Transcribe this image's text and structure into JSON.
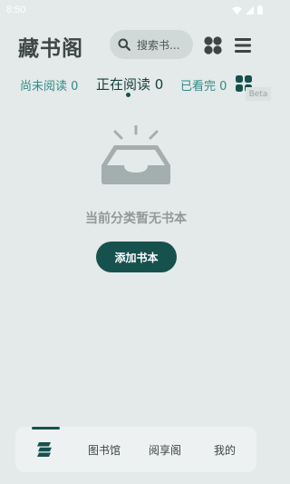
{
  "status_bar": {
    "time": "8:50",
    "icons": [
      "wifi-icon",
      "signal-icon",
      "battery-icon"
    ]
  },
  "header": {
    "title": "藏书阁",
    "search_placeholder": "搜索书...",
    "grid_icon": "apps-icon",
    "menu_icon": "menu-icon"
  },
  "tabs": [
    {
      "label": "尚未阅读 0",
      "active": false
    },
    {
      "label": "正在阅读 0",
      "active": true
    },
    {
      "label": "已看完 0",
      "active": false
    }
  ],
  "beta_badge": "Beta",
  "empty_state": {
    "icon": "empty-inbox-icon",
    "message": "当前分类暂无书本",
    "button_label": "添加书本"
  },
  "bottom_nav": {
    "items": [
      {
        "label": "",
        "icon": "bookshelf-icon",
        "active": true
      },
      {
        "label": "图书馆",
        "active": false
      },
      {
        "label": "阅享阁",
        "active": false
      },
      {
        "label": "我的",
        "active": false
      }
    ]
  },
  "colors": {
    "background": "#e4eae9",
    "accent": "#16514e",
    "tab_inactive": "#2e8b88",
    "search_bg": "#d1d9d8"
  }
}
